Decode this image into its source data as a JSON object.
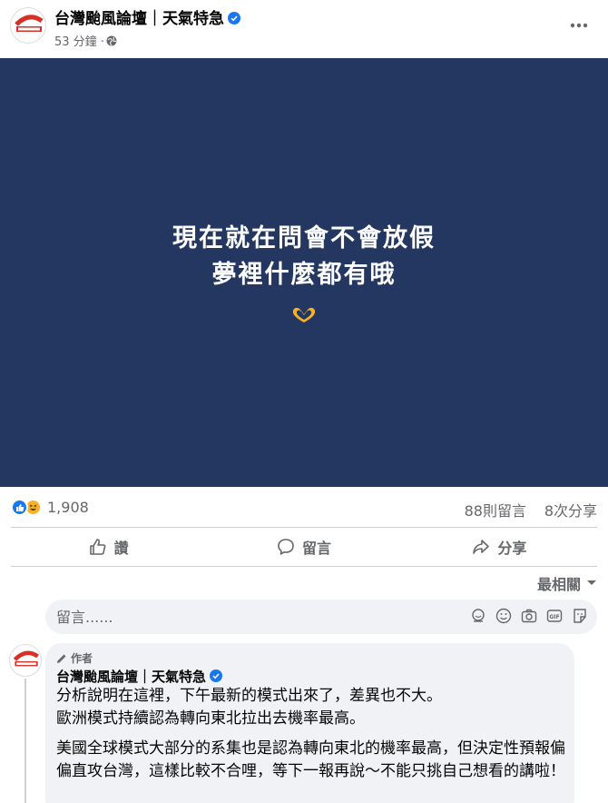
{
  "post": {
    "page_name": "台灣颱風論壇｜天氣特急",
    "time": "53 分鐘",
    "separator": "·",
    "image_text": {
      "line1": "現在就在問會不會放假",
      "line2": "夢裡什麼都有哦"
    }
  },
  "stats": {
    "reaction_count": "1,908",
    "comments": "88則留言",
    "shares": "8次分享"
  },
  "actions": {
    "like": "讚",
    "comment": "留言",
    "share": "分享"
  },
  "sort": {
    "label": "最相關"
  },
  "composer": {
    "placeholder": "留言......"
  },
  "comment": {
    "badge": "作者",
    "author": "台灣颱風論壇｜天氣特急",
    "paragraph1_line1": "分析說明在這裡，下午最新的模式出來了，差異也不大。",
    "paragraph1_line2": "歐洲模式持續認為轉向東北拉出去機率最高。",
    "paragraph2": "美國全球模式大部分的系集也是認為轉向東北的機率最高，但決定性預報偏偏直攻台灣，這樣比較不合哩，等下一報再說～不能只挑自己想看的講啦！"
  },
  "colors": {
    "image_bg": "#233761",
    "like_blue": "#1877f2",
    "verified_blue": "#1877f2",
    "secondary_text": "#65676b"
  }
}
